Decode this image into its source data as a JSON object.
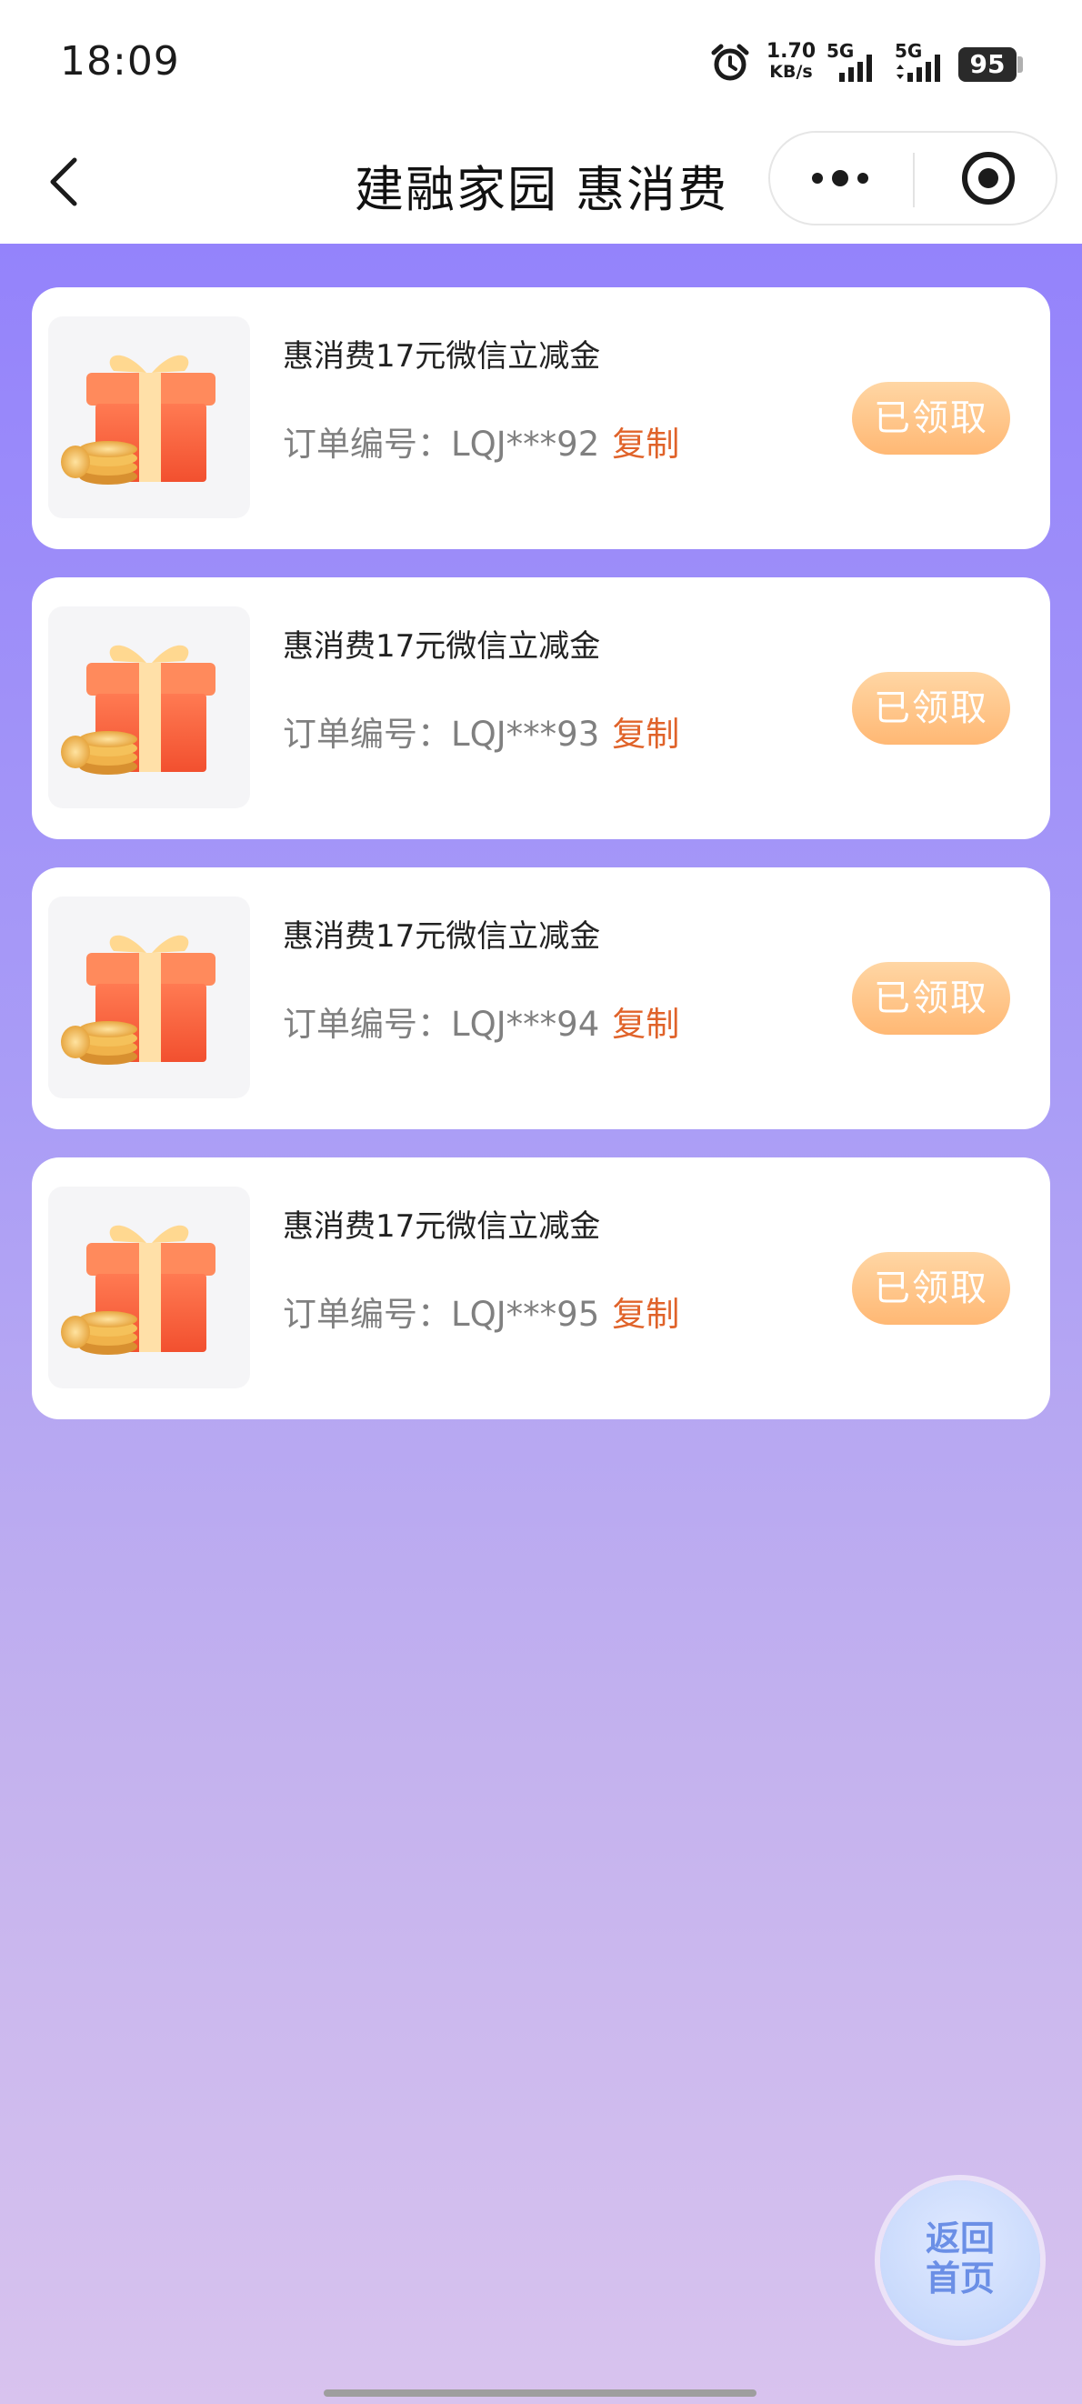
{
  "status_bar": {
    "time": "18:09",
    "net_speed_value": "1.70",
    "net_speed_unit": "KB/s",
    "signal1_label": "5G",
    "signal2_label": "5G",
    "battery": "95"
  },
  "nav": {
    "title": "建融家园 惠消费"
  },
  "cards": [
    {
      "title": "惠消费17元微信立减金",
      "order_label": "订单编号：",
      "order_no": "LQJ***92",
      "copy": "复制",
      "status": "已领取"
    },
    {
      "title": "惠消费17元微信立减金",
      "order_label": "订单编号：",
      "order_no": "LQJ***93",
      "copy": "复制",
      "status": "已领取"
    },
    {
      "title": "惠消费17元微信立减金",
      "order_label": "订单编号：",
      "order_no": "LQJ***94",
      "copy": "复制",
      "status": "已领取"
    },
    {
      "title": "惠消费17元微信立减金",
      "order_label": "订单编号：",
      "order_no": "LQJ***95",
      "copy": "复制",
      "status": "已领取"
    }
  ],
  "home_button": {
    "line1": "返回",
    "line2": "首页"
  },
  "colors": {
    "accent_copy": "#e0632a",
    "claimed_button": "#ffc58a",
    "bg_top": "#9483fb",
    "bg_bottom": "#d8c3ee"
  }
}
